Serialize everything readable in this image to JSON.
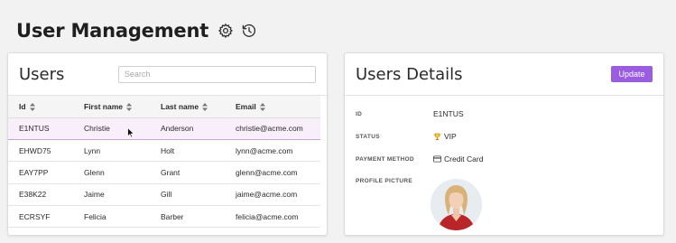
{
  "page": {
    "title": "User Management"
  },
  "users_panel": {
    "title": "Users",
    "search_placeholder": "Search",
    "columns": [
      "Id",
      "First name",
      "Last name",
      "Email"
    ],
    "rows": [
      {
        "id": "E1NTUS",
        "first": "Christie",
        "last": "Anderson",
        "email": "christie@acme.com",
        "selected": true
      },
      {
        "id": "EHWD75",
        "first": "Lynn",
        "last": "Holt",
        "email": "lynn@acme.com",
        "selected": false
      },
      {
        "id": "EAY7PP",
        "first": "Glenn",
        "last": "Grant",
        "email": "glenn@acme.com",
        "selected": false
      },
      {
        "id": "E38K22",
        "first": "Jaime",
        "last": "Gill",
        "email": "jaime@acme.com",
        "selected": false
      },
      {
        "id": "ECRSYF",
        "first": "Felicia",
        "last": "Barber",
        "email": "felicia@acme.com",
        "selected": false
      }
    ]
  },
  "details_panel": {
    "title": "Users Details",
    "update_label": "Update",
    "id_label": "ID",
    "id_value": "E1NTUS",
    "status_label": "STATUS",
    "status_value": "VIP",
    "status_icon": "trophy-icon",
    "payment_label": "PAYMENT METHOD",
    "payment_value": "Credit Card",
    "payment_icon": "credit-card-icon",
    "picture_label": "PROFILE PICTURE"
  },
  "colors": {
    "accent": "#9b5de0",
    "selected_row_bg": "#f8effa",
    "selected_row_border": "#c9a2dd",
    "trophy": "#e6a817"
  }
}
